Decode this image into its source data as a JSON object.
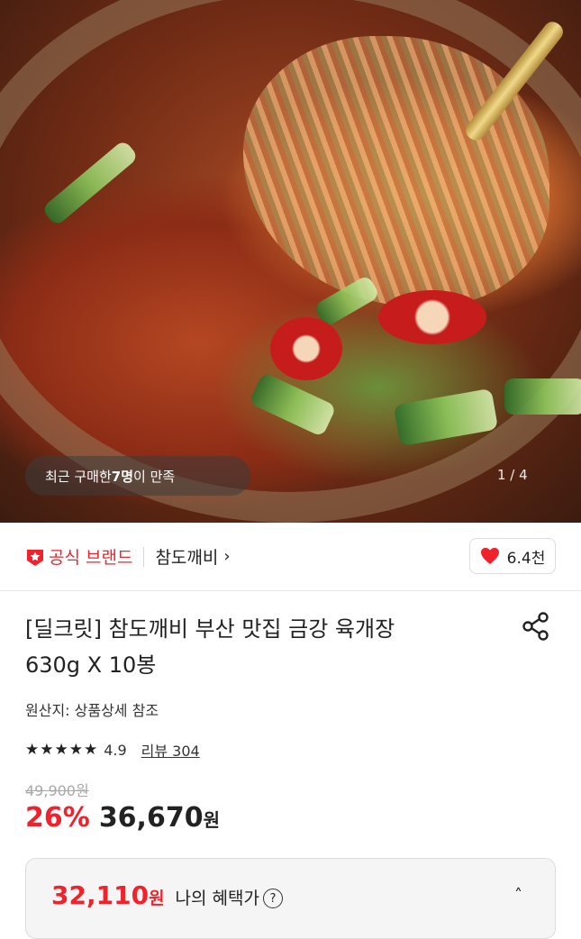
{
  "hero": {
    "review_prefix": "최근 구매한 ",
    "review_count": "7명",
    "review_suffix": "이 만족",
    "page_counter": "1 / 4"
  },
  "brand": {
    "official_label": "공식 브랜드",
    "name": "참도깨비",
    "chevron": "›",
    "likes": "6.4천",
    "accent_color": "#f0222c"
  },
  "product": {
    "title_line1": "[딜크릿] 참도깨비 부산 맛집 금강 육개장",
    "title_line2": "630g X 10봉",
    "origin": "원산지: 상품상세 참조",
    "stars": "★★★★★",
    "rating": "4.9",
    "review_link": "리뷰 304",
    "original_price": "49,900원",
    "discount": "26%",
    "price": "36,670",
    "price_unit": "원"
  },
  "benefit": {
    "price": "32,110",
    "unit": "원",
    "label": "나의 혜택가",
    "help": "?",
    "chevron": "˄"
  },
  "icons": {
    "brand_badge": "star-badge-icon",
    "like": "heart-icon",
    "share": "share-icon",
    "help": "question-circle-icon",
    "expand": "chevron-up-icon"
  }
}
